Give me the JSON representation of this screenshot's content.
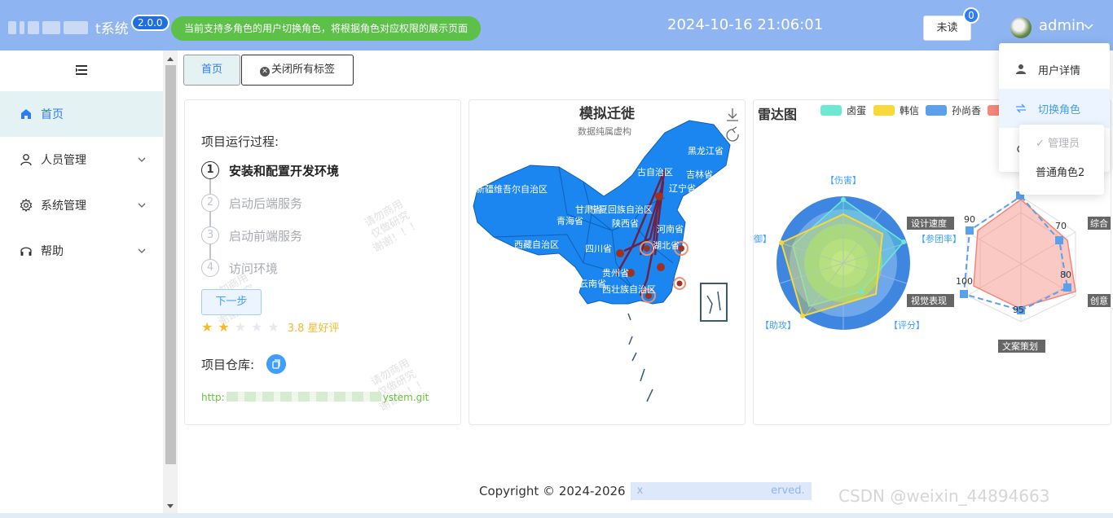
{
  "header": {
    "app_title": "t系统",
    "version": "2.0.0",
    "notice": "当前支持多角色的用户切换角色，将根据角色对应权限的展示页面",
    "datetime": "2024-10-16 21:06:01",
    "unread_label": "未读",
    "unread_count": "0",
    "username": "admin",
    "colors": {
      "header_bg": "#8fb4f2",
      "notice_bg": "#5cc049",
      "badge_bg": "#2f7cf6"
    }
  },
  "sidebar": {
    "items": [
      {
        "label": "首页",
        "icon": "home-icon",
        "active": true
      },
      {
        "label": "人员管理",
        "icon": "user-icon",
        "expandable": true
      },
      {
        "label": "系统管理",
        "icon": "gear-icon",
        "expandable": true
      },
      {
        "label": "帮助",
        "icon": "headset-icon",
        "expandable": true
      }
    ]
  },
  "tabs": [
    {
      "label": "首页",
      "active": true
    },
    {
      "label": "关闭所有标签",
      "icon": "close-circle-icon"
    }
  ],
  "project_card": {
    "steps_title": "项目运行过程:",
    "steps": [
      {
        "num": "1",
        "label": "安装和配置开发环境",
        "active": true
      },
      {
        "num": "2",
        "label": "启动后端服务"
      },
      {
        "num": "3",
        "label": "启动前端服务"
      },
      {
        "num": "4",
        "label": "访问环境"
      }
    ],
    "next_label": "下一步",
    "rating_text": "3.8 星好评",
    "rating_value": 3.8,
    "repo_label": "项目仓库:",
    "repo_link_start": "http:",
    "repo_link_end": "ystem.git",
    "watermark_lines": [
      "请勿商用",
      "仅做研究",
      "谢谢！！！"
    ]
  },
  "map_card": {
    "title": "模拟迁徙",
    "subtitle": "数据纯属虚构",
    "region_labels": [
      "黑龙江省",
      "吉林省",
      "古自治区",
      "辽宁省",
      "新疆维吾尔自治区",
      "甘肃省",
      "青海省",
      "陕西省",
      "河南省",
      "西藏自治区",
      "四川省",
      "湖北省",
      "云南省",
      "贵州省",
      "西壮族自治区",
      "宁夏回族自治区"
    ]
  },
  "radar_card": {
    "title": "雷达图",
    "legend": [
      {
        "name": "卤蛋",
        "color": "#6ee8d4"
      },
      {
        "name": "韩信",
        "color": "#f7d93a"
      },
      {
        "name": "孙尚香",
        "color": "#5aa0ea"
      },
      {
        "name": "",
        "color": "#f4877a"
      }
    ],
    "radar1_indicators": [
      "【伤害】",
      "【参团率】",
      "【评分】",
      "【助攻】",
      "御】"
    ],
    "radar2_indicators": [
      "设计速度",
      "视觉表现",
      "文案策划",
      "创意",
      "综合"
    ],
    "radar2_values": [
      "90",
      "70",
      "80",
      "95",
      "100"
    ]
  },
  "footer": {
    "copyright": "Copyright © 2024-2026",
    "rights_start": "x",
    "rights_end": "erved."
  },
  "watermark": "CSDN @weixin_44894663",
  "user_menu": {
    "items": [
      {
        "label": "用户详情",
        "icon": "person-icon"
      },
      {
        "label": "切换角色",
        "icon": "switch-icon",
        "hover": true
      }
    ],
    "roles": [
      {
        "label": "管理员",
        "checked": true,
        "disabled": true
      },
      {
        "label": "普通角色2"
      }
    ]
  }
}
